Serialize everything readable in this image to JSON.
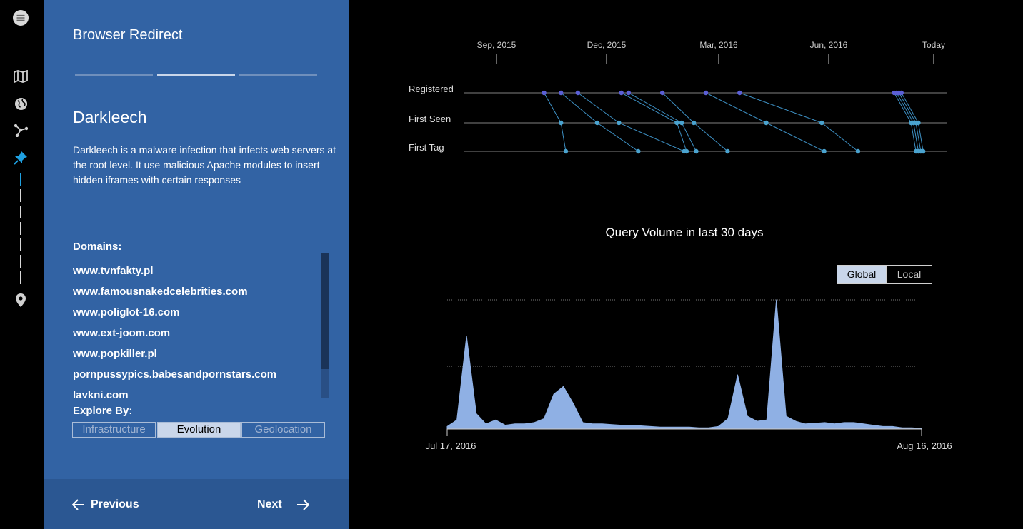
{
  "rail": {
    "icons": [
      "menu-icon",
      "map-icon",
      "globe-icon",
      "network-icon",
      "pin-icon",
      "location-icon"
    ]
  },
  "panel": {
    "title": "Browser Redirect",
    "step_total": 3,
    "step_active": 2,
    "topic_title": "Darkleech",
    "topic_description": "Darkleech is a malware infection that infects web servers at the root level. It use malicious Apache modules to insert hidden iframes with certain responses",
    "domains_label": "Domains:",
    "domains": [
      "www.tvnfakty.pl",
      "www.famousnakedcelebrities.com",
      "www.poliglot-16.com",
      "www.ext-joom.com",
      "www.popkiller.pl",
      "pornpussypics.babesandpornstars.com",
      "laykni.com"
    ],
    "explore_label": "Explore By:",
    "explore_options": [
      "Infrastructure",
      "Evolution",
      "Geolocation"
    ],
    "explore_selected": "Evolution",
    "prev_label": "Previous",
    "next_label": "Next"
  },
  "timeline": {
    "tick_labels": [
      "Sep, 2015",
      "Dec, 2015",
      "Mar, 2016",
      "Jun, 2016",
      "Today"
    ],
    "rows": [
      "Registered",
      "First Seen",
      "First Tag"
    ],
    "colors": {
      "registered": "#5b5fd6",
      "seen": "#4aa3cf",
      "line": "#3d8fc2",
      "axis": "#555555"
    },
    "domain_events": [
      {
        "registered": 0.165,
        "seen": 0.2,
        "tag": 0.21
      },
      {
        "registered": 0.2,
        "seen": 0.275,
        "tag": 0.36
      },
      {
        "registered": 0.235,
        "seen": 0.32,
        "tag": 0.455
      },
      {
        "registered": 0.325,
        "seen": 0.44,
        "tag": 0.46
      },
      {
        "registered": 0.34,
        "seen": 0.45,
        "tag": 0.48
      },
      {
        "registered": 0.41,
        "seen": 0.475,
        "tag": 0.545
      },
      {
        "registered": 0.5,
        "seen": 0.625,
        "tag": 0.745
      },
      {
        "registered": 0.57,
        "seen": 0.74,
        "tag": 0.815
      },
      {
        "registered": 0.89,
        "seen": 0.925,
        "tag": 0.935
      },
      {
        "registered": 0.895,
        "seen": 0.93,
        "tag": 0.94
      },
      {
        "registered": 0.9,
        "seen": 0.935,
        "tag": 0.945
      },
      {
        "registered": 0.905,
        "seen": 0.94,
        "tag": 0.95
      }
    ]
  },
  "volume": {
    "title": "Query Volume in last 30 days",
    "scope_options": [
      "Global",
      "Local"
    ],
    "scope_selected": "Global",
    "start_label": "Jul 17, 2016",
    "end_label": "Aug 16, 2016",
    "fill_color": "#8fb0e4",
    "series": [
      0.02,
      0.07,
      0.72,
      0.12,
      0.04,
      0.07,
      0.03,
      0.04,
      0.04,
      0.05,
      0.08,
      0.27,
      0.33,
      0.2,
      0.05,
      0.04,
      0.04,
      0.035,
      0.03,
      0.025,
      0.025,
      0.02,
      0.015,
      0.015,
      0.015,
      0.015,
      0.01,
      0.01,
      0.02,
      0.08,
      0.42,
      0.1,
      0.06,
      0.07,
      1.0,
      0.1,
      0.06,
      0.04,
      0.045,
      0.05,
      0.04,
      0.05,
      0.05,
      0.04,
      0.03,
      0.02,
      0.02,
      0.01,
      0.01,
      0.005
    ]
  }
}
